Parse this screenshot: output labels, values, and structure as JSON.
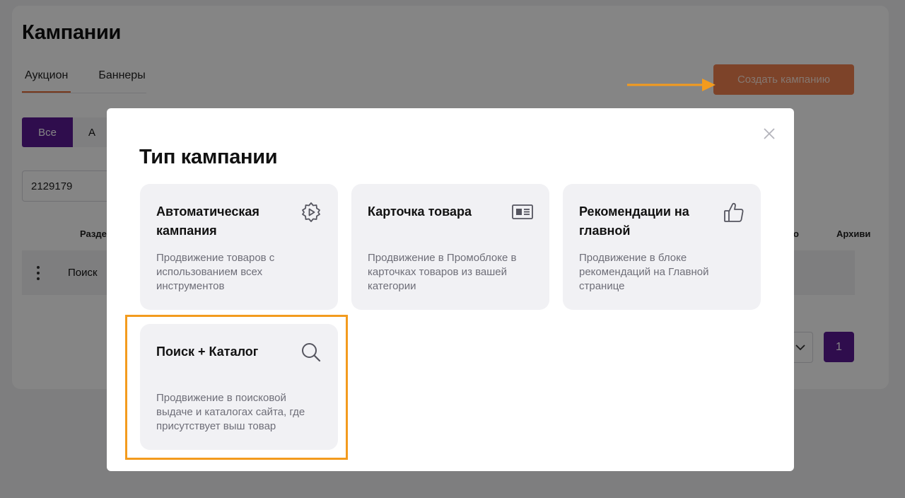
{
  "page": {
    "title": "Кампании",
    "tabs": [
      {
        "label": "Аукцион",
        "active": true
      },
      {
        "label": "Баннеры",
        "active": false
      }
    ],
    "create_button": "Создать кампанию",
    "filters": {
      "all": "Все",
      "next_partial": "А"
    },
    "search_value": "2129179",
    "table": {
      "headers": {
        "section": "Раздел",
        "col_partial": "о",
        "archive": "Архиви"
      },
      "row": {
        "section": "Поиск"
      }
    },
    "pagination": {
      "current_page": "1"
    }
  },
  "modal": {
    "title": "Тип кампании",
    "cards": [
      {
        "title": "Автоматическая кампания",
        "description": "Продвижение товаров с использованием всех инструментов",
        "icon": "gear-play-icon"
      },
      {
        "title": "Карточка товара",
        "description": "Продвижение в Промоблоке в карточках товаров из вашей категории",
        "icon": "product-card-icon"
      },
      {
        "title": "Рекомендации на главной",
        "description": "Продвижение в блоке рекомендаций на Главной странице",
        "icon": "thumbs-up-icon"
      },
      {
        "title": "Поиск + Каталог",
        "description": "Продвижение в поисковой выдаче и каталогах сайта, где присутствует выш товар",
        "icon": "search-icon"
      }
    ]
  },
  "colors": {
    "accent_orange": "#f0804f",
    "brand_purple": "#5a1a95",
    "annotation_orange": "#f39b1e"
  }
}
